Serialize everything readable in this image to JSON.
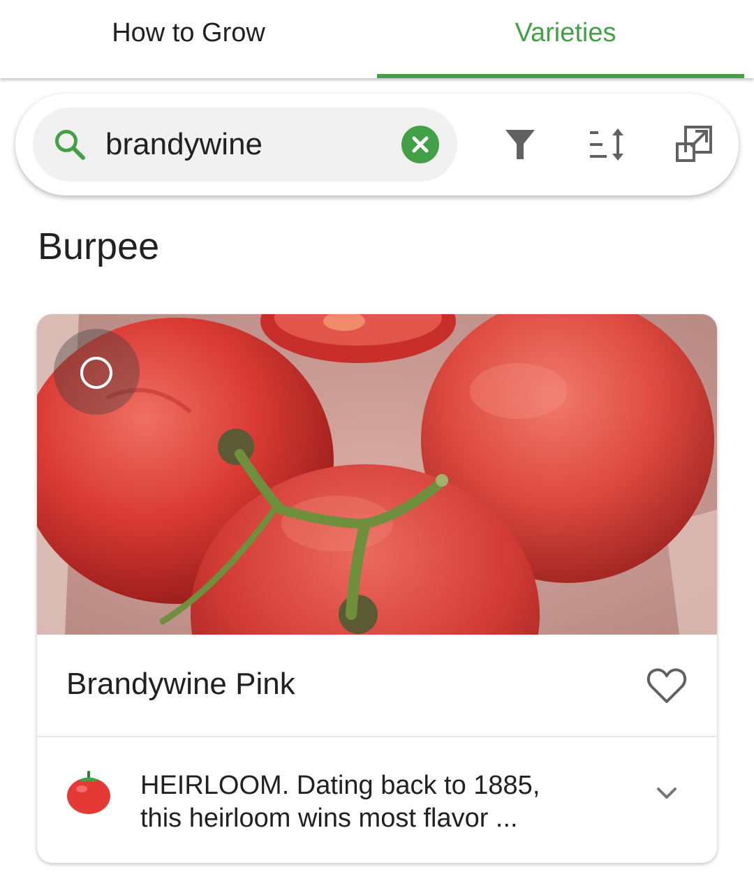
{
  "tabs": [
    {
      "label": "How to Grow",
      "active": false
    },
    {
      "label": "Varieties",
      "active": true
    }
  ],
  "search": {
    "value": "brandywine",
    "icon": "search-icon",
    "clear_icon": "close-circle-icon"
  },
  "toolbar": {
    "filter_icon": "filter-icon",
    "sort_icon": "sort-icon",
    "expand_icon": "open-in-new-icon"
  },
  "section": {
    "title": "Burpee"
  },
  "card": {
    "title": "Brandywine Pink",
    "favorite_icon": "heart-outline-icon",
    "select_icon": "circle-outline-icon",
    "type_icon": "tomato-icon",
    "description_line1": "HEIRLOOM. Dating back to 1885,",
    "description_line2": "this heirloom wins most flavor ...",
    "expand_icon": "chevron-down-icon"
  },
  "colors": {
    "accent": "#43a047",
    "text": "#212121",
    "icon_gray": "#616161",
    "search_bg": "#f1f1f1"
  }
}
